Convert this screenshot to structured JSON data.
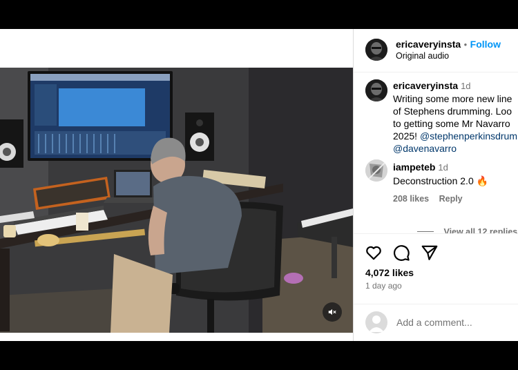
{
  "post": {
    "author": "ericaveryinsta",
    "separator": "•",
    "follow_label": "Follow",
    "audio": "Original audio"
  },
  "caption": {
    "author": "ericaveryinsta",
    "time": "1d",
    "lines": [
      "Writing some more new line",
      "of Stephens drumming. Loo",
      "to getting some Mr Navarro"
    ],
    "line4_prefix": "2025!",
    "mention1": "@stephenperkinsdrum",
    "mention2": "@davenavarro"
  },
  "reply": {
    "author": "iampeteb",
    "time": "1d",
    "text": "Deconstruction 2.0 🔥",
    "likes": "208 likes",
    "reply_label": "Reply",
    "view_replies": "View all 12 replies"
  },
  "stats": {
    "likes": "4,072 likes",
    "time": "1 day ago"
  },
  "comment_box": {
    "placeholder": "Add a comment..."
  },
  "icons": {
    "like": "heart-icon",
    "comment": "comment-bubble-icon",
    "share": "paper-plane-icon",
    "mute": "speaker-muted-icon"
  }
}
